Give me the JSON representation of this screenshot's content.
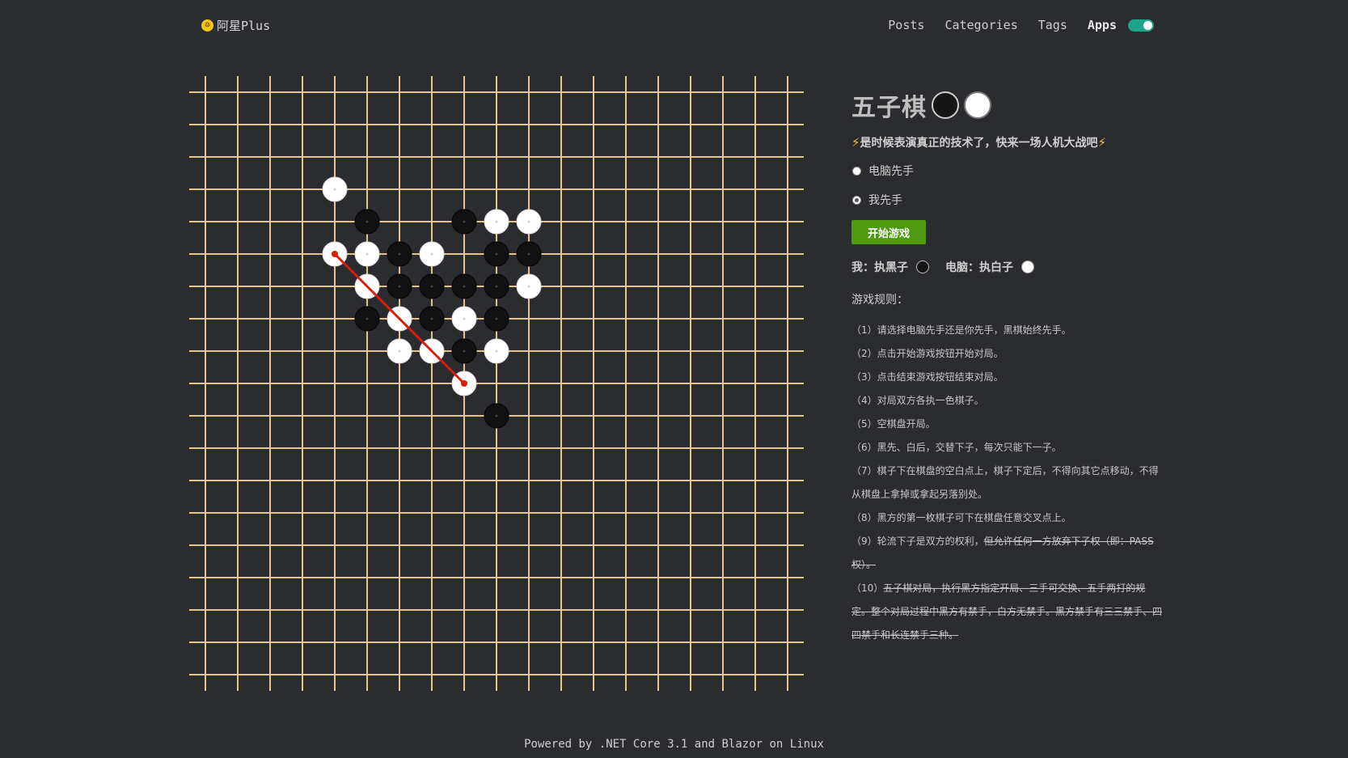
{
  "header": {
    "logo_text": "阿星Plus",
    "nav": [
      "Posts",
      "Categories",
      "Tags",
      "Apps"
    ],
    "active_nav": "Apps",
    "theme_toggle_on": true
  },
  "colors": {
    "background": "#2b2c30",
    "board_lines": "#e8c48d",
    "win_line": "#d81e06",
    "start_button": "#4f9a10",
    "toggle": "#1fa38b"
  },
  "board": {
    "size": 19,
    "stones": [
      {
        "col": 4,
        "row": 3,
        "color": "white"
      },
      {
        "col": 5,
        "row": 4,
        "color": "black"
      },
      {
        "col": 8,
        "row": 4,
        "color": "black"
      },
      {
        "col": 9,
        "row": 4,
        "color": "white"
      },
      {
        "col": 10,
        "row": 4,
        "color": "white"
      },
      {
        "col": 4,
        "row": 5,
        "color": "white"
      },
      {
        "col": 5,
        "row": 5,
        "color": "white"
      },
      {
        "col": 6,
        "row": 5,
        "color": "black"
      },
      {
        "col": 7,
        "row": 5,
        "color": "white"
      },
      {
        "col": 9,
        "row": 5,
        "color": "black"
      },
      {
        "col": 10,
        "row": 5,
        "color": "black"
      },
      {
        "col": 5,
        "row": 6,
        "color": "white"
      },
      {
        "col": 6,
        "row": 6,
        "color": "black"
      },
      {
        "col": 7,
        "row": 6,
        "color": "black"
      },
      {
        "col": 8,
        "row": 6,
        "color": "black"
      },
      {
        "col": 9,
        "row": 6,
        "color": "black"
      },
      {
        "col": 10,
        "row": 6,
        "color": "white"
      },
      {
        "col": 5,
        "row": 7,
        "color": "black"
      },
      {
        "col": 6,
        "row": 7,
        "color": "white"
      },
      {
        "col": 7,
        "row": 7,
        "color": "black"
      },
      {
        "col": 8,
        "row": 7,
        "color": "white"
      },
      {
        "col": 9,
        "row": 7,
        "color": "black"
      },
      {
        "col": 6,
        "row": 8,
        "color": "white"
      },
      {
        "col": 7,
        "row": 8,
        "color": "white"
      },
      {
        "col": 8,
        "row": 8,
        "color": "black"
      },
      {
        "col": 9,
        "row": 8,
        "color": "white"
      },
      {
        "col": 8,
        "row": 9,
        "color": "white"
      },
      {
        "col": 9,
        "row": 10,
        "color": "black"
      }
    ],
    "win_line": [
      {
        "col": 4,
        "row": 5
      },
      {
        "col": 5,
        "row": 6
      },
      {
        "col": 6,
        "row": 7
      },
      {
        "col": 7,
        "row": 8
      },
      {
        "col": 8,
        "row": 9
      }
    ]
  },
  "panel": {
    "title": "五子棋",
    "subtitle": "是时候表演真正的技术了，快来一场人机大战吧",
    "option_computer_first": "电脑先手",
    "option_me_first": "我先手",
    "selected_option": "我先手",
    "start_button": "开始游戏",
    "me_label": "我：执黑子",
    "computer_label": "电脑：执白子",
    "rules_title": "游戏规则：",
    "rules": [
      {
        "num": "（1）",
        "text": "请选择电脑先手还是你先手，黑棋始终先手。",
        "strike": ""
      },
      {
        "num": "（2）",
        "text": "点击开始游戏按钮开始对局。",
        "strike": ""
      },
      {
        "num": "（3）",
        "text": "点击结束游戏按钮结束对局。",
        "strike": ""
      },
      {
        "num": "（4）",
        "text": "对局双方各执一色棋子。",
        "strike": ""
      },
      {
        "num": "（5）",
        "text": "空棋盘开局。",
        "strike": ""
      },
      {
        "num": "（6）",
        "text": "黑先、白后，交替下子，每次只能下一子。",
        "strike": ""
      },
      {
        "num": "（7）",
        "text": "棋子下在棋盘的空白点上，棋子下定后，不得向其它点移动，不得从棋盘上拿掉或拿起另落别处。",
        "strike": ""
      },
      {
        "num": "（8）",
        "text": "黑方的第一枚棋子可下在棋盘任意交叉点上。",
        "strike": ""
      },
      {
        "num": "（9）",
        "text": "轮流下子是双方的权利，",
        "strike": "但允许任何一方放弃下子权（即：PASS权）。"
      },
      {
        "num": "（10）",
        "text": "",
        "strike": "五子棋对局，执行黑方指定开局、三手可交换、五手两打的规定。整个对局过程中黑方有禁手，白方无禁手。黑方禁手有三三禁手、四四禁手和长连禁手三种。"
      }
    ]
  },
  "footer": "Powered by .NET Core 3.1 and Blazor on Linux"
}
